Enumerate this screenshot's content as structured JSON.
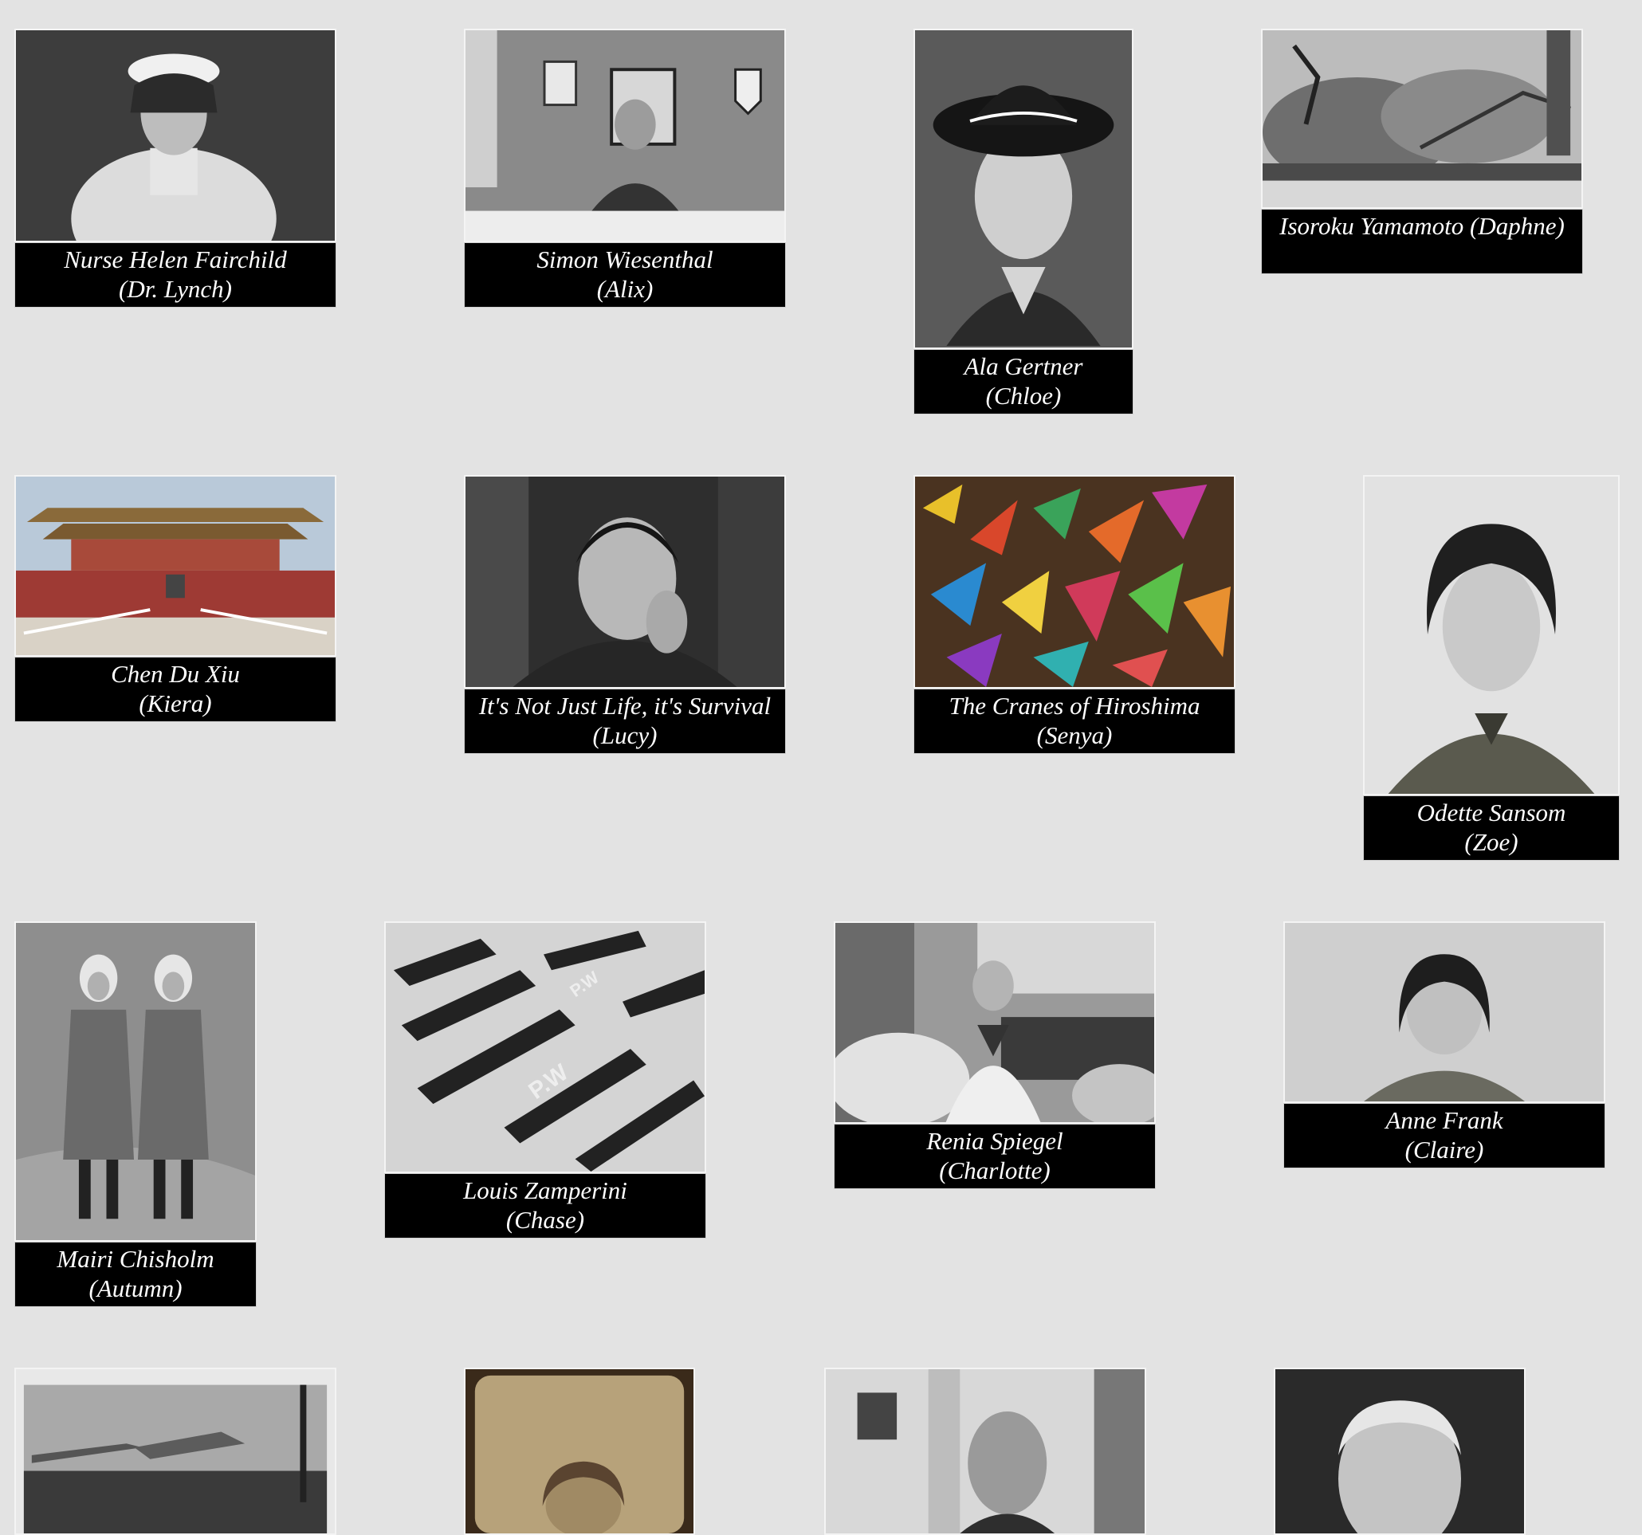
{
  "gallery": {
    "items": [
      {
        "name": "Nurse Helen Fairchild",
        "student": "(Dr. Lynch)",
        "photo": "portrait-nurse-photo"
      },
      {
        "name": "Simon Wiesenthal",
        "student": "(Alix)",
        "photo": "man-at-desk-photo"
      },
      {
        "name": "Ala Gertner",
        "student": "(Chloe)",
        "photo": "woman-in-hat-photo"
      },
      {
        "name": "Isoroku Yamamoto (Daphne)",
        "student": "",
        "photo": "burning-battleship-photo"
      },
      {
        "name": "Chen Du Xiu",
        "student": "(Kiera)",
        "photo": "tiananmen-gate-photo"
      },
      {
        "name": "It's Not Just Life, it's Survival",
        "student": "(Lucy)",
        "photo": "elderly-woman-portrait-photo"
      },
      {
        "name": "The Cranes of Hiroshima",
        "student": "(Senya)",
        "photo": "paper-cranes-photo"
      },
      {
        "name": "Odette Sansom",
        "student": "(Zoe)",
        "photo": "woman-in-uniform-photo"
      },
      {
        "name": "Mairi Chisholm",
        "student": "(Autumn)",
        "photo": "two-nurses-photo"
      },
      {
        "name": "Louis Zamperini",
        "student": "(Chase)",
        "photo": "pow-camp-aerial-photo"
      },
      {
        "name": "Renia Spiegel",
        "student": "(Charlotte)",
        "photo": "woman-with-flowers-photo"
      },
      {
        "name": "Anne Frank",
        "student": "(Claire)",
        "photo": "girl-portrait-photo"
      },
      {
        "name": "",
        "student": "",
        "photo": "camp-crowd-photo"
      },
      {
        "name": "",
        "student": "",
        "photo": "sepia-woman-photo"
      },
      {
        "name": "",
        "student": "",
        "photo": "elderly-man-photo"
      },
      {
        "name": "",
        "student": "",
        "photo": "man-portrait-photo"
      }
    ]
  }
}
